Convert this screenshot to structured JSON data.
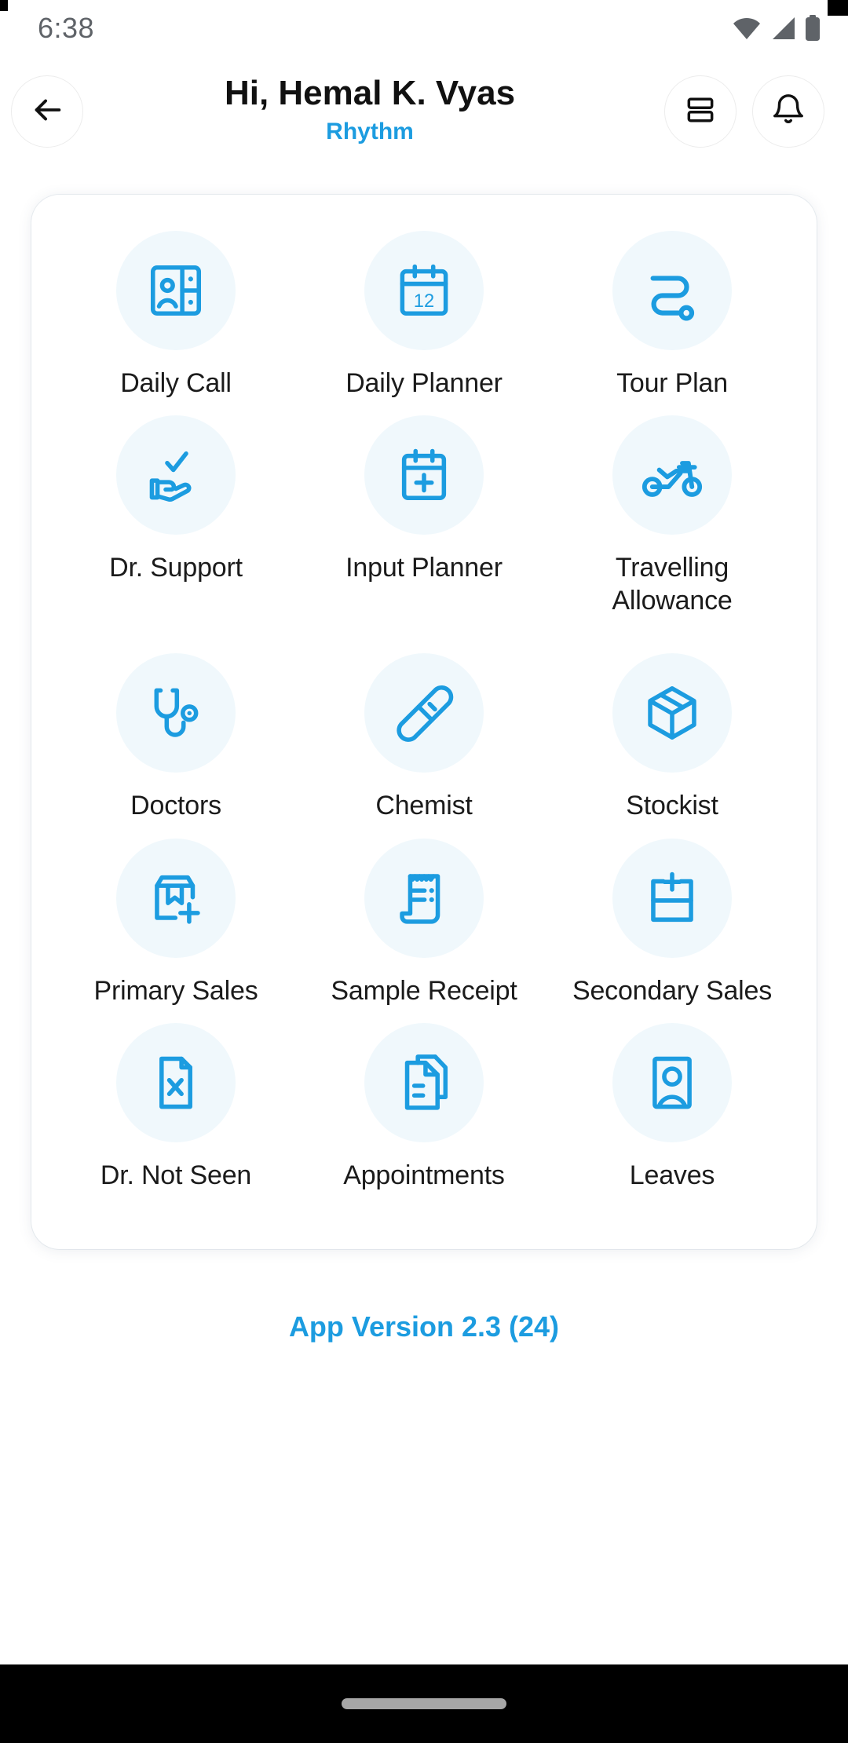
{
  "status_bar": {
    "time": "6:38",
    "icons": [
      "wifi-icon",
      "signal-icon",
      "battery-icon"
    ]
  },
  "app_bar": {
    "back_icon": "back-arrow-icon",
    "greeting": "Hi, Hemal K. Vyas",
    "subtitle": "Rhythm",
    "actions": [
      {
        "name": "layout-toggle-icon",
        "label": "layout-toggle"
      },
      {
        "name": "notification-bell-icon",
        "label": "notifications"
      }
    ]
  },
  "menu": {
    "items": [
      {
        "label": "Daily Call",
        "icon": "contact-card-icon"
      },
      {
        "label": "Daily Planner",
        "icon": "calendar-12-icon"
      },
      {
        "label": "Tour Plan",
        "icon": "route-path-icon"
      },
      {
        "label": "Dr. Support",
        "icon": "hand-check-icon"
      },
      {
        "label": "Input Planner",
        "icon": "calendar-plus-icon"
      },
      {
        "label": "Travelling Allowance",
        "icon": "motorcycle-icon"
      },
      {
        "label": "Doctors",
        "icon": "stethoscope-icon"
      },
      {
        "label": "Chemist",
        "icon": "pill-capsule-icon"
      },
      {
        "label": "Stockist",
        "icon": "package-box-icon"
      },
      {
        "label": "Primary Sales",
        "icon": "box-bookmark-plus-icon"
      },
      {
        "label": "Sample Receipt",
        "icon": "receipt-icon"
      },
      {
        "label": "Secondary Sales",
        "icon": "box-plus-icon"
      },
      {
        "label": "Dr. Not Seen",
        "icon": "document-x-icon"
      },
      {
        "label": "Appointments",
        "icon": "documents-stack-icon"
      },
      {
        "label": "Leaves",
        "icon": "person-card-icon"
      }
    ]
  },
  "footer": {
    "version_label": "App Version 2.3 (24)"
  },
  "nav_bar": {
    "handle": "home-indicator"
  },
  "colors": {
    "accent": "#1c9ce0",
    "icon_bg": "#f0f8fc",
    "text": "#1b1b1b",
    "status_text": "#5f6368"
  }
}
